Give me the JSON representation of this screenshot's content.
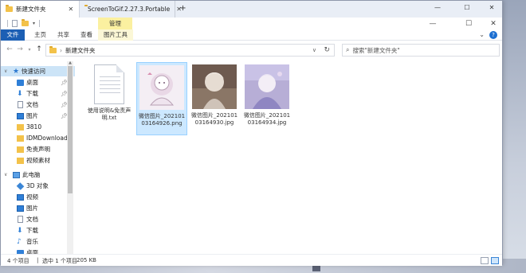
{
  "tabs": [
    {
      "title": "新建文件夹",
      "close": "✕",
      "active": true
    },
    {
      "title": "ScreenToGif.2.27.3.Portable",
      "close": "✕",
      "active": false
    }
  ],
  "tab_add": "+",
  "window_controls": {
    "minimize": "—",
    "maximize": "☐",
    "close": "✕"
  },
  "window_controls_2": {
    "minimize": "—",
    "maximize": "☐",
    "close": "✕"
  },
  "manage_tab": "管理",
  "ribbon": {
    "file": "文件",
    "home": "主页",
    "share": "共享",
    "view": "查看",
    "picture_tools": "图片工具",
    "help": "?"
  },
  "address": {
    "path": "新建文件夹",
    "refresh": "↻"
  },
  "search": {
    "placeholder": "搜索\"新建文件夹\""
  },
  "nav": {
    "quick_access": "快速访问",
    "desktop": "桌面",
    "downloads": "下载",
    "documents": "文档",
    "pictures": "图片",
    "f3810": "3810",
    "idm": "IDMDownload",
    "disclaimer": "免责声明",
    "video_material": "视频素材",
    "this_pc": "此电脑",
    "objects3d": "3D 对象",
    "videos": "视频",
    "pictures2": "图片",
    "documents2": "文档",
    "downloads2": "下载",
    "music": "音乐",
    "desktop2": "桌面"
  },
  "files": [
    {
      "name": "使用说明&免责声明.txt",
      "type": "txt"
    },
    {
      "name": "微信图片_20210103164926.png",
      "type": "image"
    },
    {
      "name": "微信图片_20210103164930.jpg",
      "type": "image"
    },
    {
      "name": "微信图片_20210103164934.jpg",
      "type": "image"
    }
  ],
  "status": {
    "count": "4 个项目",
    "selected": "选中 1 个项目",
    "size": "205 KB"
  },
  "colors": {
    "accent": "#1c5fb4",
    "selection": "#cce8ff",
    "manage": "#fbf0a0"
  }
}
